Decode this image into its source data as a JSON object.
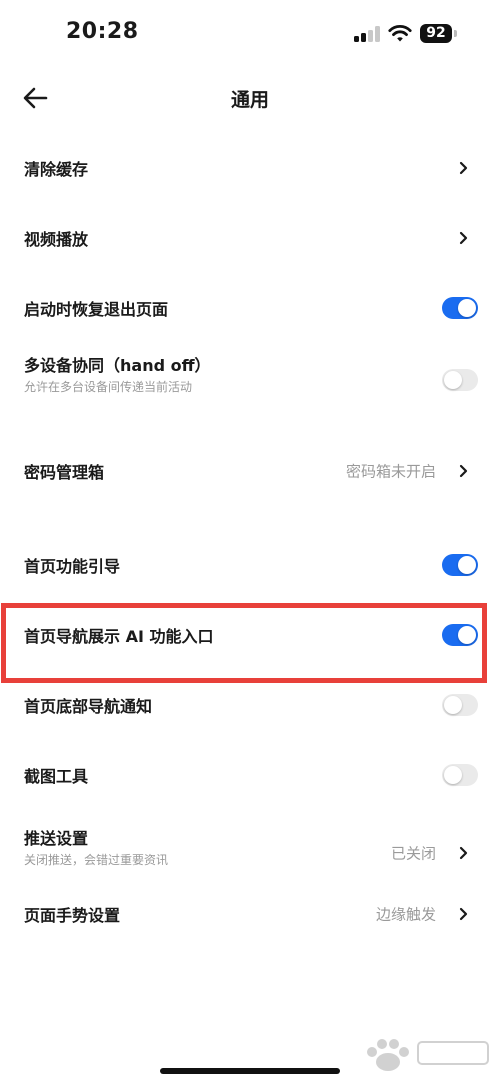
{
  "status_bar": {
    "time": "20:28",
    "battery": "92"
  },
  "nav": {
    "title": "通用",
    "back_icon": "arrow-left-icon"
  },
  "settings": {
    "clear_cache": {
      "label": "清除缓存"
    },
    "video_playback": {
      "label": "视频播放"
    },
    "restore_on_launch": {
      "label": "启动时恢复退出页面",
      "enabled": true
    },
    "handoff": {
      "label": "多设备协同（hand off）",
      "subtitle": "允许在多台设备间传递当前活动",
      "enabled": false
    },
    "password_manager": {
      "label": "密码管理箱",
      "value": "密码箱未开启"
    },
    "home_guide": {
      "label": "首页功能引导",
      "enabled": true
    },
    "home_ai_entry": {
      "label": "首页导航展示 AI 功能入口",
      "enabled": true
    },
    "home_bottom_notice": {
      "label": "首页底部导航通知",
      "enabled": false
    },
    "screenshot_tool": {
      "label": "截图工具",
      "enabled": false
    },
    "push_settings": {
      "label": "推送设置",
      "subtitle": "关闭推送，会错过重要资讯",
      "value": "已关闭"
    },
    "gesture_settings": {
      "label": "页面手势设置",
      "value": "边缘触发"
    }
  },
  "colors": {
    "toggle_on": "#1a6cf0",
    "toggle_off": "#eaeaea",
    "highlight": "#e8403a"
  }
}
